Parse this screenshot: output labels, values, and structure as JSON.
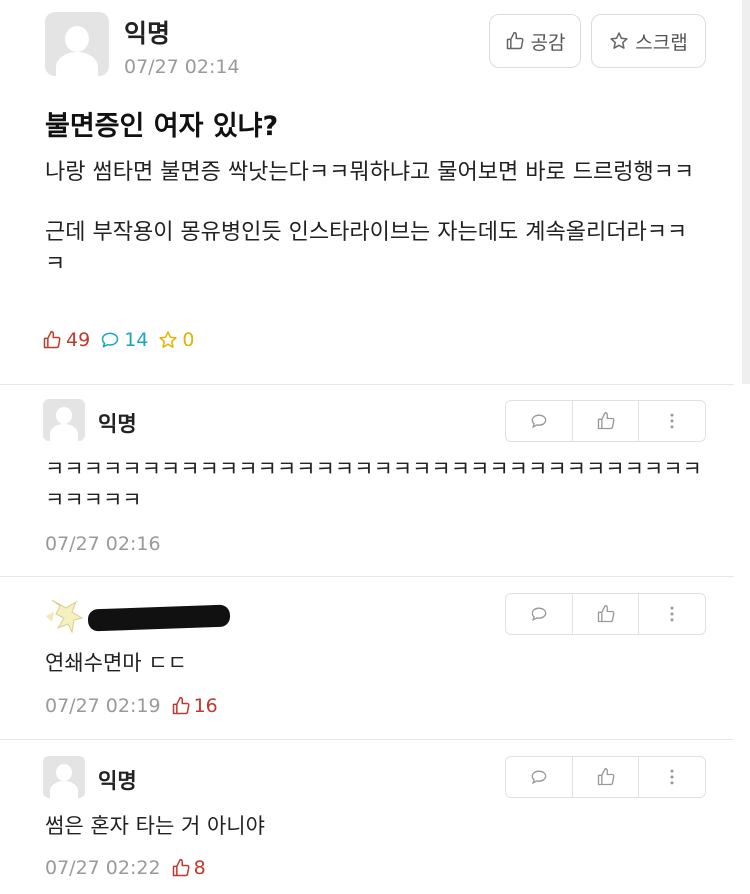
{
  "post": {
    "author": "익명",
    "time": "07/27 02:14",
    "buttons": {
      "like": "공감",
      "scrap": "스크랩"
    },
    "title": "불면증인 여자 있냐?",
    "body": [
      "나랑 썸타면 불면증 싹낫는다ㅋㅋ뭐하냐고 물어보면 바로 드르렁행ㅋㅋ",
      "근데 부작용이 몽유병인듯 인스타라이브는 자는데도 계속올리더라ㅋㅋㅋ"
    ],
    "stats": {
      "likes": "49",
      "comments": "14",
      "scraps": "0"
    }
  },
  "comments": [
    {
      "author": "익명",
      "text": "ㅋㅋㅋㅋㅋㅋㅋㅋㅋㅋㅋㅋㅋㅋㅋㅋㅋㅋㅋㅋㅋㅋㅋㅋㅋㅋㅋㅋㅋㅋㅋㅋㅋㅋㅋㅋㅋㅋㅋ",
      "time": "07/27 02:16",
      "likes": ""
    },
    {
      "author": "",
      "text": "연쇄수면마 ㄷㄷ",
      "time": "07/27 02:19",
      "likes": "16"
    },
    {
      "author": "익명",
      "text": "썸은 혼자 타는 거 아니야",
      "time": "07/27 02:22",
      "likes": "8"
    }
  ],
  "colors": {
    "like": "#c0392b",
    "comment": "#1aa3c4",
    "scrap": "#e0b400",
    "meta": "#9a9a9a"
  }
}
